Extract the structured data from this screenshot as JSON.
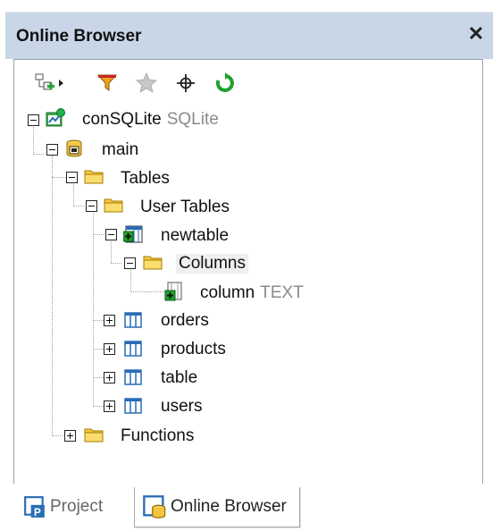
{
  "panel": {
    "title": "Online Browser",
    "close_glyph": "✕"
  },
  "toolbar": {
    "buttons": [
      {
        "name": "add-datasource-icon"
      },
      {
        "name": "dropdown-arrow-icon"
      },
      {
        "name": "filter-icon"
      },
      {
        "name": "favorites-star-icon"
      },
      {
        "name": "locate-crosshair-icon"
      },
      {
        "name": "refresh-icon"
      }
    ]
  },
  "tree": {
    "root": {
      "label": "conSQLite",
      "sub": "SQLite"
    },
    "schema": {
      "label": "main"
    },
    "tables_folder": {
      "label": "Tables"
    },
    "user_tables_folder": {
      "label": "User Tables"
    },
    "newtable": {
      "label": "newtable"
    },
    "columns_folder": {
      "label": "Columns"
    },
    "column": {
      "label": "column",
      "sub": "TEXT"
    },
    "tables": [
      {
        "label": "orders"
      },
      {
        "label": "products"
      },
      {
        "label": "table"
      },
      {
        "label": "users"
      }
    ],
    "functions_folder": {
      "label": "Functions"
    }
  },
  "tabs": [
    {
      "label": "Project",
      "active": false
    },
    {
      "label": "Online Browser",
      "active": true
    }
  ],
  "colors": {
    "titlebar": "#c9d6e7",
    "folder": "#f4c842",
    "table_icon": "#2a6db5",
    "green": "#1fa12b"
  }
}
